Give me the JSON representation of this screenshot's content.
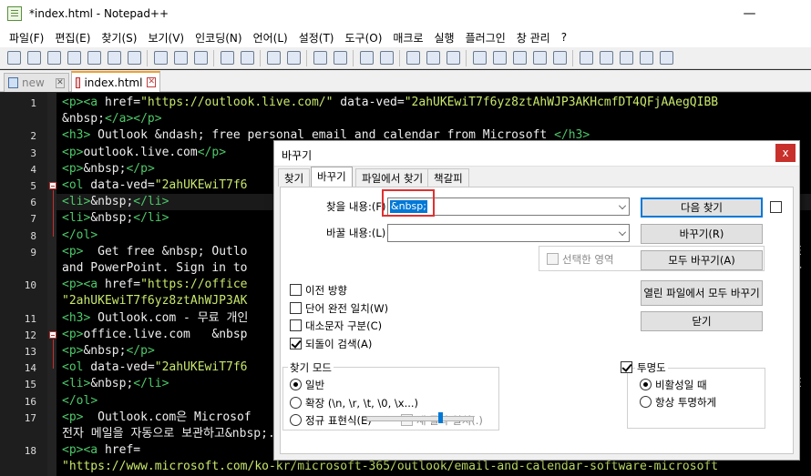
{
  "window": {
    "title": "*index.html - Notepad++"
  },
  "menu": [
    "파일(F)",
    "편집(E)",
    "찾기(S)",
    "보기(V)",
    "인코딩(N)",
    "언어(L)",
    "설정(T)",
    "도구(O)",
    "매크로",
    "실행",
    "플러그인",
    "창 관리",
    "?"
  ],
  "tabs": [
    {
      "label": "new",
      "active": false
    },
    {
      "label": "index.html",
      "active": true
    }
  ],
  "editor": {
    "lines": [
      {
        "num": "1",
        "text": "<p><a href=\"https://outlook.live.com/\" data-ved=\"2ahUKEwiT7f6yz8ztAhWJP3AKHcmfDT4QFjAAegQIBB"
      },
      {
        "num": "",
        "text": "&nbsp;</a></p>"
      },
      {
        "num": "2",
        "text": "<h3> Outlook &ndash; free personal email and calendar from Microsoft </h3>"
      },
      {
        "num": "3",
        "text": "<p>outlook.live.com</p>"
      },
      {
        "num": "4",
        "text": "<p>&nbsp;</p>"
      },
      {
        "num": "5",
        "text": "<ol data-ved=\"2ahUKEwiT7f6"
      },
      {
        "num": "6",
        "text": "<li>&nbsp;</li>"
      },
      {
        "num": "7",
        "text": "<li>&nbsp;</li>"
      },
      {
        "num": "8",
        "text": "</ol>"
      },
      {
        "num": "9",
        "text": "<p>  Get free &nbsp; Outlo"
      },
      {
        "num": "",
        "text": "and PowerPoint. Sign in to"
      },
      {
        "num": "10",
        "text": "<p><a href=\"https://office"
      },
      {
        "num": "",
        "text": "\"2ahUKEwiT7f6yz8ztAhWJP3AK"
      },
      {
        "num": "11",
        "text": "<h3> Outlook.com - 무료 개인"
      },
      {
        "num": "12",
        "text": "<p>office.live.com   &nbsp"
      },
      {
        "num": "13",
        "text": "<p>&nbsp;</p>"
      },
      {
        "num": "14",
        "text": "<ol data-ved=\"2ahUKEwiT7f6"
      },
      {
        "num": "15",
        "text": "<li>&nbsp;</li>"
      },
      {
        "num": "16",
        "text": "</ol>"
      },
      {
        "num": "17",
        "text": "<p>  Outlook.com은 Microsof"
      },
      {
        "num": "",
        "text": "전자 메일을 자동으로 보관하고&nbsp;..."
      },
      {
        "num": "18",
        "text": "<p><a href="
      },
      {
        "num": "",
        "text": "\"https://www.microsoft.com/ko-kr/microsoft-365/outlook/email-and-calendar-software-microsoft"
      }
    ],
    "right_fragments": [
      {
        "line": 9,
        "text": "E"
      },
      {
        "line": 10,
        "text": ">"
      },
      {
        "line": 17,
        "text": "E"
      }
    ]
  },
  "dialog": {
    "title": "바꾸기",
    "close": "x",
    "tabs": [
      "찾기",
      "바꾸기",
      "파일에서 찾기",
      "책갈피"
    ],
    "find_label": "찾을 내용:(F)",
    "find_value": "&nbsp;",
    "replace_label": "바꿀 내용:(L)",
    "replace_value": "",
    "in_selection": "선택한 영역",
    "buttons": {
      "find_next": "다음 찾기",
      "replace": "바꾸기(R)",
      "replace_all": "모두 바꾸기(A)",
      "replace_all_open": "열린 파일에서 모두 바꾸기",
      "close": "닫기"
    },
    "options": [
      {
        "label": "이전 방향",
        "checked": false
      },
      {
        "label": "단어 완전 일치(W)",
        "checked": false
      },
      {
        "label": "대소문자 구분(C)",
        "checked": false
      },
      {
        "label": "되돌이 검색(A)",
        "checked": true
      }
    ],
    "search_mode": {
      "title": "찾기 모드",
      "modes": [
        {
          "label": "일반",
          "selected": true
        },
        {
          "label": "확장 (\\n, \\r, \\t, \\0, \\x...)",
          "selected": false
        },
        {
          "label": "정규 표현식(E)",
          "selected": false
        }
      ],
      "dot_newline": "새 줄과 일치(.)"
    },
    "transparency": {
      "title": "투명도",
      "enabled": true,
      "modes": [
        {
          "label": "비활성일 때",
          "selected": true
        },
        {
          "label": "항상 투명하게",
          "selected": false
        }
      ],
      "level": 0.7
    }
  }
}
